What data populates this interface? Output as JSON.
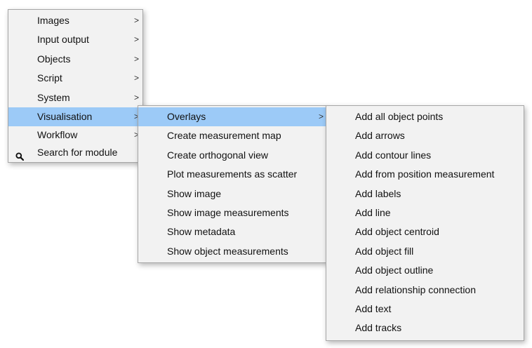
{
  "colors": {
    "menu_background": "#f2f2f2",
    "selected_background": "#9ccaf7",
    "border": "#a6a6a6"
  },
  "main_menu": {
    "items": [
      {
        "label": "Images",
        "submenu_arrow": ">"
      },
      {
        "label": "Input output",
        "submenu_arrow": ">"
      },
      {
        "label": "Objects",
        "submenu_arrow": ">"
      },
      {
        "label": "Script",
        "submenu_arrow": ">"
      },
      {
        "label": "System",
        "submenu_arrow": ">"
      },
      {
        "label": "Visualisation",
        "submenu_arrow": ">",
        "selected": true
      },
      {
        "label": "Workflow",
        "submenu_arrow": ">"
      },
      {
        "label": "Search for module",
        "icon": "search-icon"
      }
    ]
  },
  "visualisation_menu": {
    "items": [
      {
        "label": "Overlays",
        "submenu_arrow": ">",
        "selected": true
      },
      {
        "label": "Create measurement map"
      },
      {
        "label": "Create orthogonal view"
      },
      {
        "label": "Plot measurements as scatter"
      },
      {
        "label": "Show image"
      },
      {
        "label": "Show image measurements"
      },
      {
        "label": "Show metadata"
      },
      {
        "label": "Show object measurements"
      }
    ]
  },
  "overlays_menu": {
    "items": [
      {
        "label": "Add all object points"
      },
      {
        "label": "Add arrows"
      },
      {
        "label": "Add contour lines"
      },
      {
        "label": "Add from position measurement"
      },
      {
        "label": "Add labels"
      },
      {
        "label": "Add line"
      },
      {
        "label": "Add object centroid"
      },
      {
        "label": "Add object fill"
      },
      {
        "label": "Add object outline"
      },
      {
        "label": "Add relationship connection"
      },
      {
        "label": "Add text"
      },
      {
        "label": "Add tracks"
      }
    ]
  }
}
